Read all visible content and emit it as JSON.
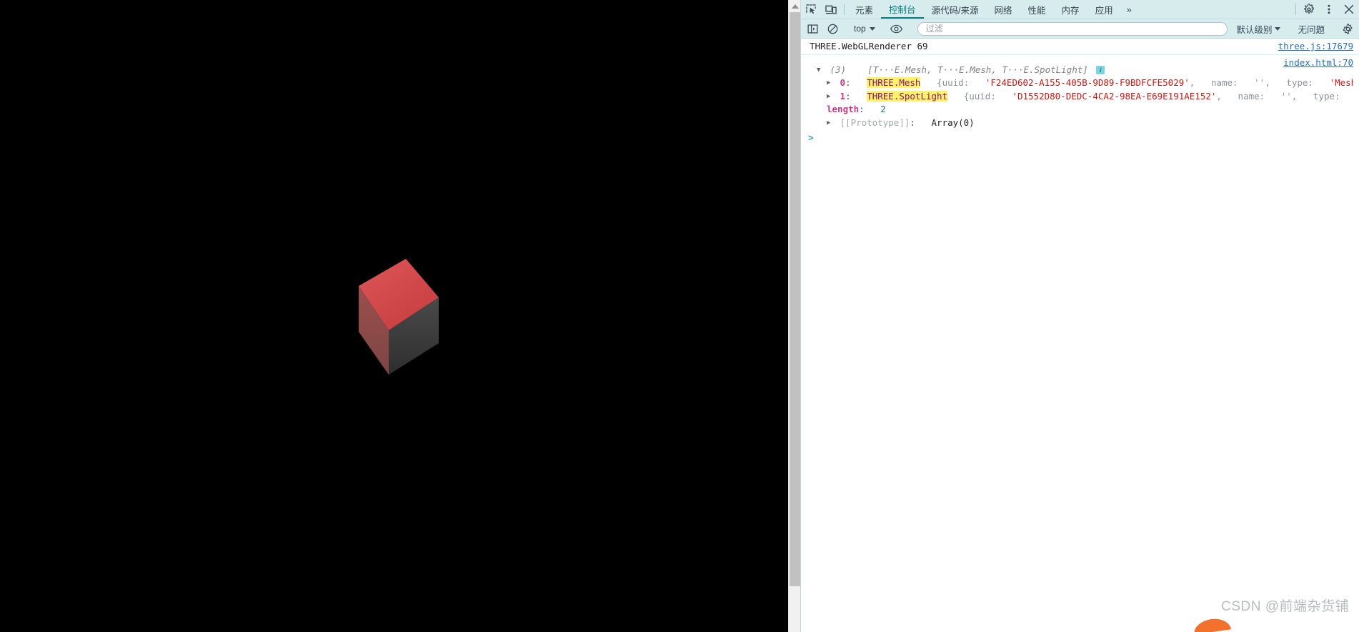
{
  "page": {
    "canvas": {
      "background": "#000000",
      "object": "rotating-cube",
      "top_face_color": "#d84a4a",
      "left_face_color": "#8e4a48",
      "right_face_color": "#3c3c3c"
    }
  },
  "devtools": {
    "tabbar": {
      "inspect_icon": "inspect-element-icon",
      "device_icon": "device-toolbar-icon",
      "tabs": [
        {
          "label": "元素",
          "name": "elements",
          "active": false
        },
        {
          "label": "控制台",
          "name": "console",
          "active": true
        },
        {
          "label": "源代码/来源",
          "name": "sources",
          "active": false
        },
        {
          "label": "网络",
          "name": "network",
          "active": false
        },
        {
          "label": "性能",
          "name": "performance",
          "active": false
        },
        {
          "label": "内存",
          "name": "memory",
          "active": false
        },
        {
          "label": "应用",
          "name": "application",
          "active": false
        }
      ],
      "more_label": "»",
      "settings_icon": "gear-icon",
      "kebab_icon": "more-vertical-icon",
      "close_icon": "close-icon"
    },
    "toolbar": {
      "sidebar_icon": "console-sidebar-icon",
      "clear_icon": "clear-console-icon",
      "context": "top",
      "eye_icon": "live-expression-eye-icon",
      "filter_placeholder": "过滤",
      "filter_value": "",
      "level": "默认级别",
      "issues": "无问题",
      "settings_icon": "console-settings-gear-icon"
    },
    "console": {
      "messages": [
        {
          "text": "THREE.WebGLRenderer 69",
          "source": "three.js:17679"
        }
      ],
      "group": {
        "source": "index.html:70",
        "twisty": "▼",
        "count": "(3)",
        "preview": "[T···E.Mesh, T···E.Mesh, T···E.SpotLight]",
        "badge": "i",
        "entries": [
          {
            "twisty": "▶",
            "index": "0",
            "class": "THREE.Mesh",
            "rest_open": "{",
            "uuid_key": "uuid",
            "uuid_value": "'F24ED602-A155-405B-9D89-F9BDFCFE5029'",
            "name_key": "name",
            "name_value": "''",
            "type_key": "type",
            "type_value": "'Mesh'",
            "tail": ","
          },
          {
            "twisty": "▶",
            "index": "1",
            "class": "THREE.SpotLight",
            "rest_open": "{",
            "uuid_key": "uuid",
            "uuid_value": "'D1552D80-DEDC-4CA2-98EA-E69E191AE152'",
            "name_key": "name",
            "name_value": "''",
            "type_key": "type",
            "type_value": "'",
            "tail": ""
          }
        ],
        "length_key": "length",
        "length_value": "2",
        "proto_twisty": "▶",
        "proto_key": "[[Prototype]]",
        "proto_value": "Array(0)"
      },
      "prompt_chevron": ">"
    }
  },
  "watermark": {
    "text": "CSDN @前端杂货铺"
  }
}
